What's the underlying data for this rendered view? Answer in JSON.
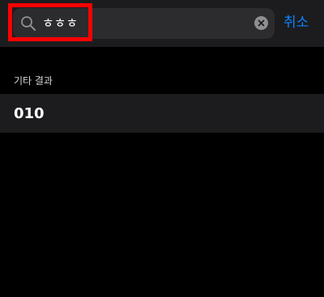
{
  "search": {
    "value": "ㅎㅎㅎ",
    "icon": "search-icon",
    "clear_icon": "clear-circle-icon"
  },
  "cancel_label": "취소",
  "section": {
    "title": "기타 결과"
  },
  "results": [
    {
      "label": "010"
    }
  ],
  "colors": {
    "accent": "#0a84ff",
    "highlight": "#ff0000",
    "background": "#000000",
    "bar": "#1c1c1e",
    "field": "#2c2c2e"
  }
}
